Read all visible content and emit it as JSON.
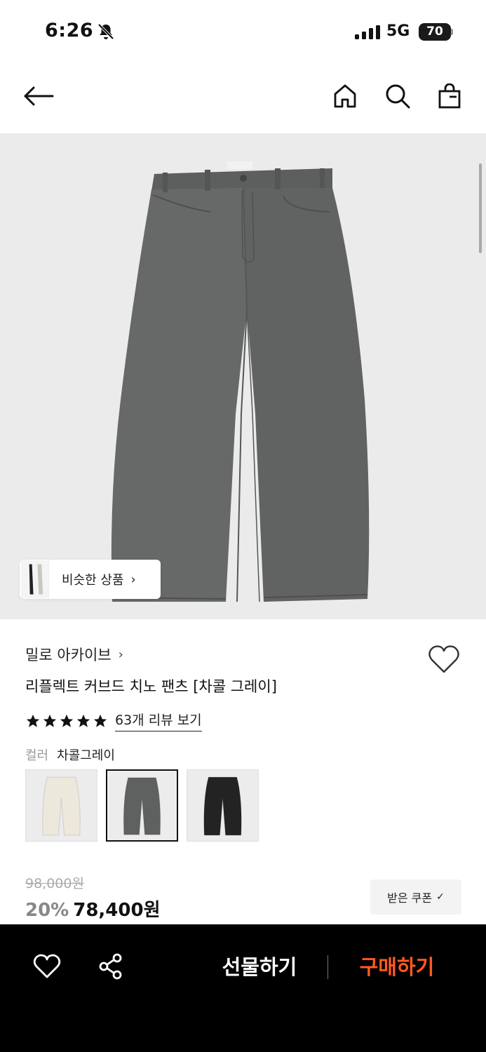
{
  "status_bar": {
    "time": "6:26",
    "network": "5G",
    "battery": "70",
    "icons": [
      "bell-off-icon",
      "signal-bars-icon",
      "battery-icon"
    ]
  },
  "top_nav": {
    "icons": [
      "back-arrow-icon",
      "home-icon",
      "search-icon",
      "shopping-bag-icon"
    ]
  },
  "hero": {
    "similar_label": "비슷한 상품",
    "similar_chevron": "›"
  },
  "product": {
    "brand": "밀로 아카이브",
    "brand_chevron": "›",
    "title": "리플렉트 커브드 치노 팬츠 [차콜 그레이]",
    "rating_stars": 5,
    "review_link": "63개 리뷰 보기",
    "color_label": "컬러",
    "color_value": "차콜그레이",
    "swatches": [
      {
        "color_hex": "#ede8dc",
        "selected": false
      },
      {
        "color_hex": "#5f6060",
        "selected": true
      },
      {
        "color_hex": "#232323",
        "selected": false
      }
    ]
  },
  "price": {
    "original": "98,000원",
    "discount": "20%",
    "sale": "78,400원"
  },
  "coupon": {
    "label": "받은 쿠폰",
    "check": "✓"
  },
  "bottom_bar": {
    "gift_label": "선물하기",
    "buy_label": "구매하기",
    "buy_color": "#ff5a1f"
  },
  "colors": {
    "accent": "#ff5a1f",
    "pants": "#636464",
    "hero_bg": "#ebebeb"
  }
}
